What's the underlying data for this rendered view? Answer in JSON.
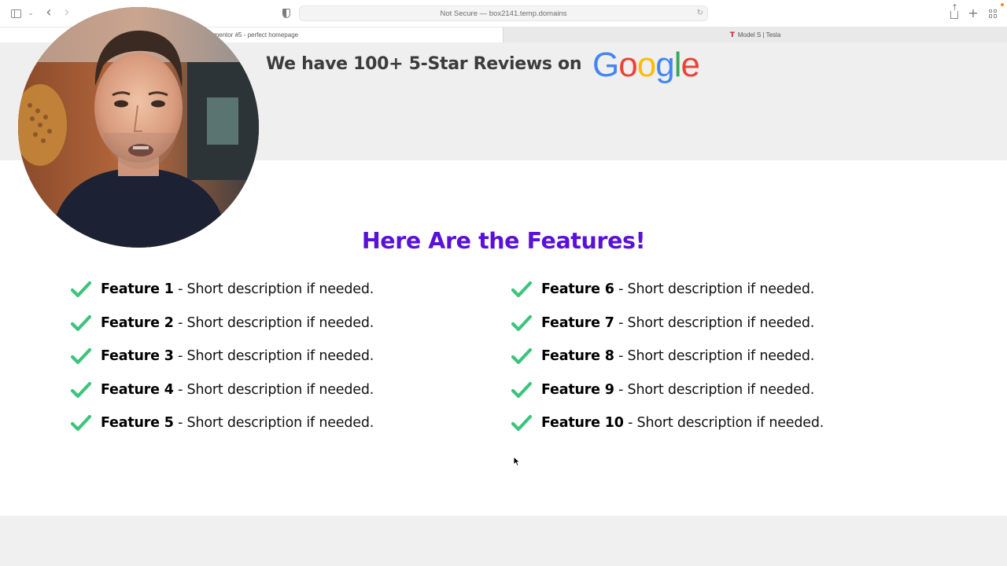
{
  "browser": {
    "address_text": "Not Secure — box2141.temp.domains",
    "tabs": [
      {
        "label": "Elementor #5 - perfect homepage"
      },
      {
        "label": "Model S | Tesla"
      }
    ]
  },
  "reviews": {
    "text": "We have 100+ 5-Star Reviews on",
    "logo_letters": [
      "G",
      "o",
      "o",
      "g",
      "l",
      "e"
    ],
    "logo_colors": [
      "#4285F4",
      "#EA4335",
      "#FBBC05",
      "#4285F4",
      "#34A853",
      "#EA4335"
    ]
  },
  "features": {
    "title": "Here Are the Features!",
    "title_color": "#5a10d8",
    "check_color": "#3cc47c",
    "left": [
      {
        "name": "Feature 1",
        "desc": " - Short description if needed."
      },
      {
        "name": "Feature 2",
        "desc": " - Short description if needed."
      },
      {
        "name": "Feature 3",
        "desc": " - Short description if needed."
      },
      {
        "name": "Feature 4",
        "desc": " - Short description if needed."
      },
      {
        "name": "Feature 5",
        "desc": " - Short description if needed."
      }
    ],
    "right": [
      {
        "name": "Feature 6",
        "desc": " - Short description if needed."
      },
      {
        "name": "Feature 7",
        "desc": " - Short description if needed."
      },
      {
        "name": "Feature 8",
        "desc": " - Short description if needed."
      },
      {
        "name": "Feature 9",
        "desc": " - Short description if needed."
      },
      {
        "name": "Feature 10",
        "desc": " - Short description if needed."
      }
    ]
  },
  "icons": {
    "sidebar": "sidebar-icon",
    "back": "back-arrow-icon",
    "forward": "forward-arrow-icon",
    "privacy": "shield-icon",
    "reload": "reload-icon",
    "share": "share-icon",
    "new_tab": "plus-icon",
    "tab_overview": "tab-grid-icon",
    "check": "checkmark-icon"
  }
}
